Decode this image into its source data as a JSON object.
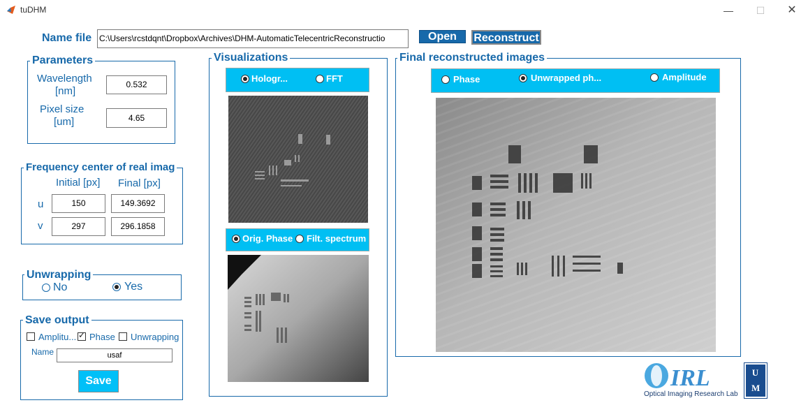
{
  "window": {
    "title": "tuDHM",
    "minimize": "—",
    "maximize": "☐",
    "close": "✕"
  },
  "file": {
    "label": "Name file",
    "path": "C:\\Users\\rcstdqnt\\Dropbox\\Archives\\DHM-AutomaticTelecentricReconstructio",
    "open_label": "Open",
    "reconstruct_label": "Reconstruct"
  },
  "parameters": {
    "title": "Parameters",
    "wavelength_label_1": "Wavelength",
    "wavelength_label_2": "[nm]",
    "wavelength_value": "0.532",
    "pixel_label_1": "Pixel size",
    "pixel_label_2": "[um]",
    "pixel_value": "4.65"
  },
  "frequency": {
    "title": "Frequency center of real imag",
    "initial_header": "Initial [px]",
    "final_header": "Final [px]",
    "u_label": "u",
    "v_label": "v",
    "u_initial": "150",
    "u_final": "149.3692",
    "v_initial": "297",
    "v_final": "296.1858"
  },
  "unwrapping": {
    "title": "Unwrapping",
    "no_label": "No",
    "yes_label": "Yes",
    "selected": "Yes"
  },
  "save": {
    "title": "Save output",
    "amplitude_label": "Amplitu...",
    "phase_label": "Phase",
    "unwrapping_label": "Unwrapping",
    "amplitude_checked": false,
    "phase_checked": true,
    "unwrapping_checked": false,
    "name_label": "Name",
    "name_value": "usaf",
    "save_label": "Save"
  },
  "visualizations": {
    "title": "Visualizations",
    "top_options": [
      "Hologr...",
      "FFT"
    ],
    "top_selected": "Hologr...",
    "bottom_options": [
      "Orig. Phase",
      "Filt. spectrum"
    ],
    "bottom_selected": "Orig. Phase"
  },
  "final": {
    "title": "Final reconstructed images",
    "options": [
      "Phase",
      "Unwrapped ph...",
      "Amplitude"
    ],
    "selected": "Unwrapped ph..."
  },
  "logo": {
    "text": "Optical Imaging Research Lab",
    "mark": "OIRL",
    "side": "UM"
  },
  "colors": {
    "accent": "#1769aa",
    "cyan": "#00bff3"
  }
}
